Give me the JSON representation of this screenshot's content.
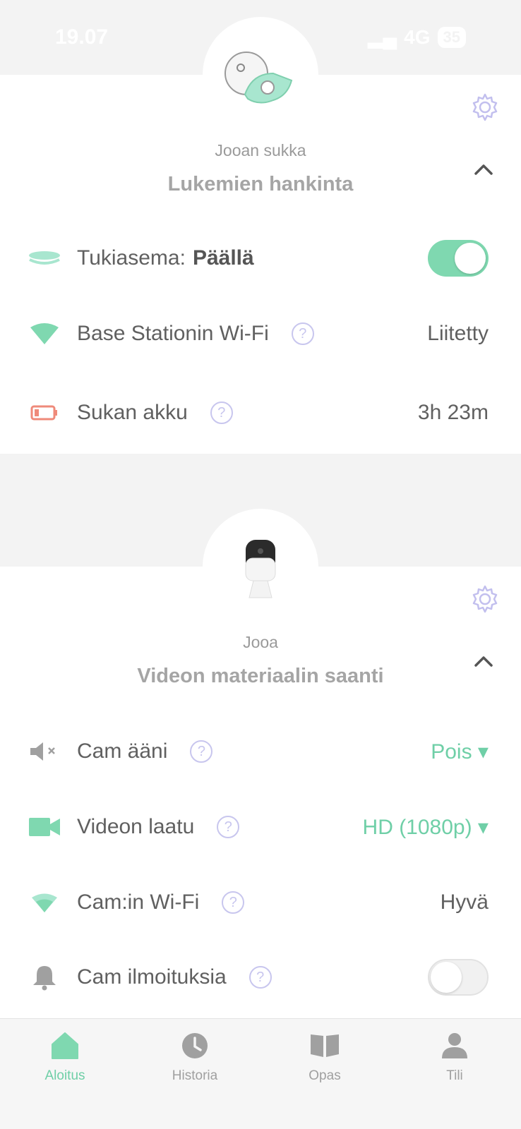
{
  "status_bar": {
    "time": "19.07",
    "network": "4G",
    "battery": "35"
  },
  "sock_card": {
    "device_name": "Jooan sukka",
    "status": "Lukemien hankinta",
    "base_station": {
      "label": "Tukiasema:",
      "value": "Päällä",
      "toggle_on": true
    },
    "wifi": {
      "label": "Base Stationin Wi-Fi",
      "value": "Liitetty"
    },
    "battery": {
      "label": "Sukan akku",
      "value": "3h 23m"
    }
  },
  "cam_card": {
    "device_name": "Jooa",
    "status": "Videon materiaalin saanti",
    "sound": {
      "label": "Cam ääni",
      "value": "Pois ▾"
    },
    "quality": {
      "label": "Videon laatu",
      "value": "HD (1080p) ▾"
    },
    "wifi": {
      "label": "Cam:in Wi-Fi",
      "value": "Hyvä"
    },
    "notifications": {
      "label": "Cam ilmoituksia",
      "toggle_on": false
    }
  },
  "help_glyph": "?",
  "tabs": [
    {
      "label": "Aloitus",
      "icon": "home-icon",
      "active": true
    },
    {
      "label": "Historia",
      "icon": "clock-icon",
      "active": false
    },
    {
      "label": "Opas",
      "icon": "book-icon",
      "active": false
    },
    {
      "label": "Tili",
      "icon": "person-icon",
      "active": false
    }
  ],
  "colors": {
    "accent": "#6fcfa7",
    "help": "#c8c6ee",
    "battery_low": "#ef8a7a"
  }
}
